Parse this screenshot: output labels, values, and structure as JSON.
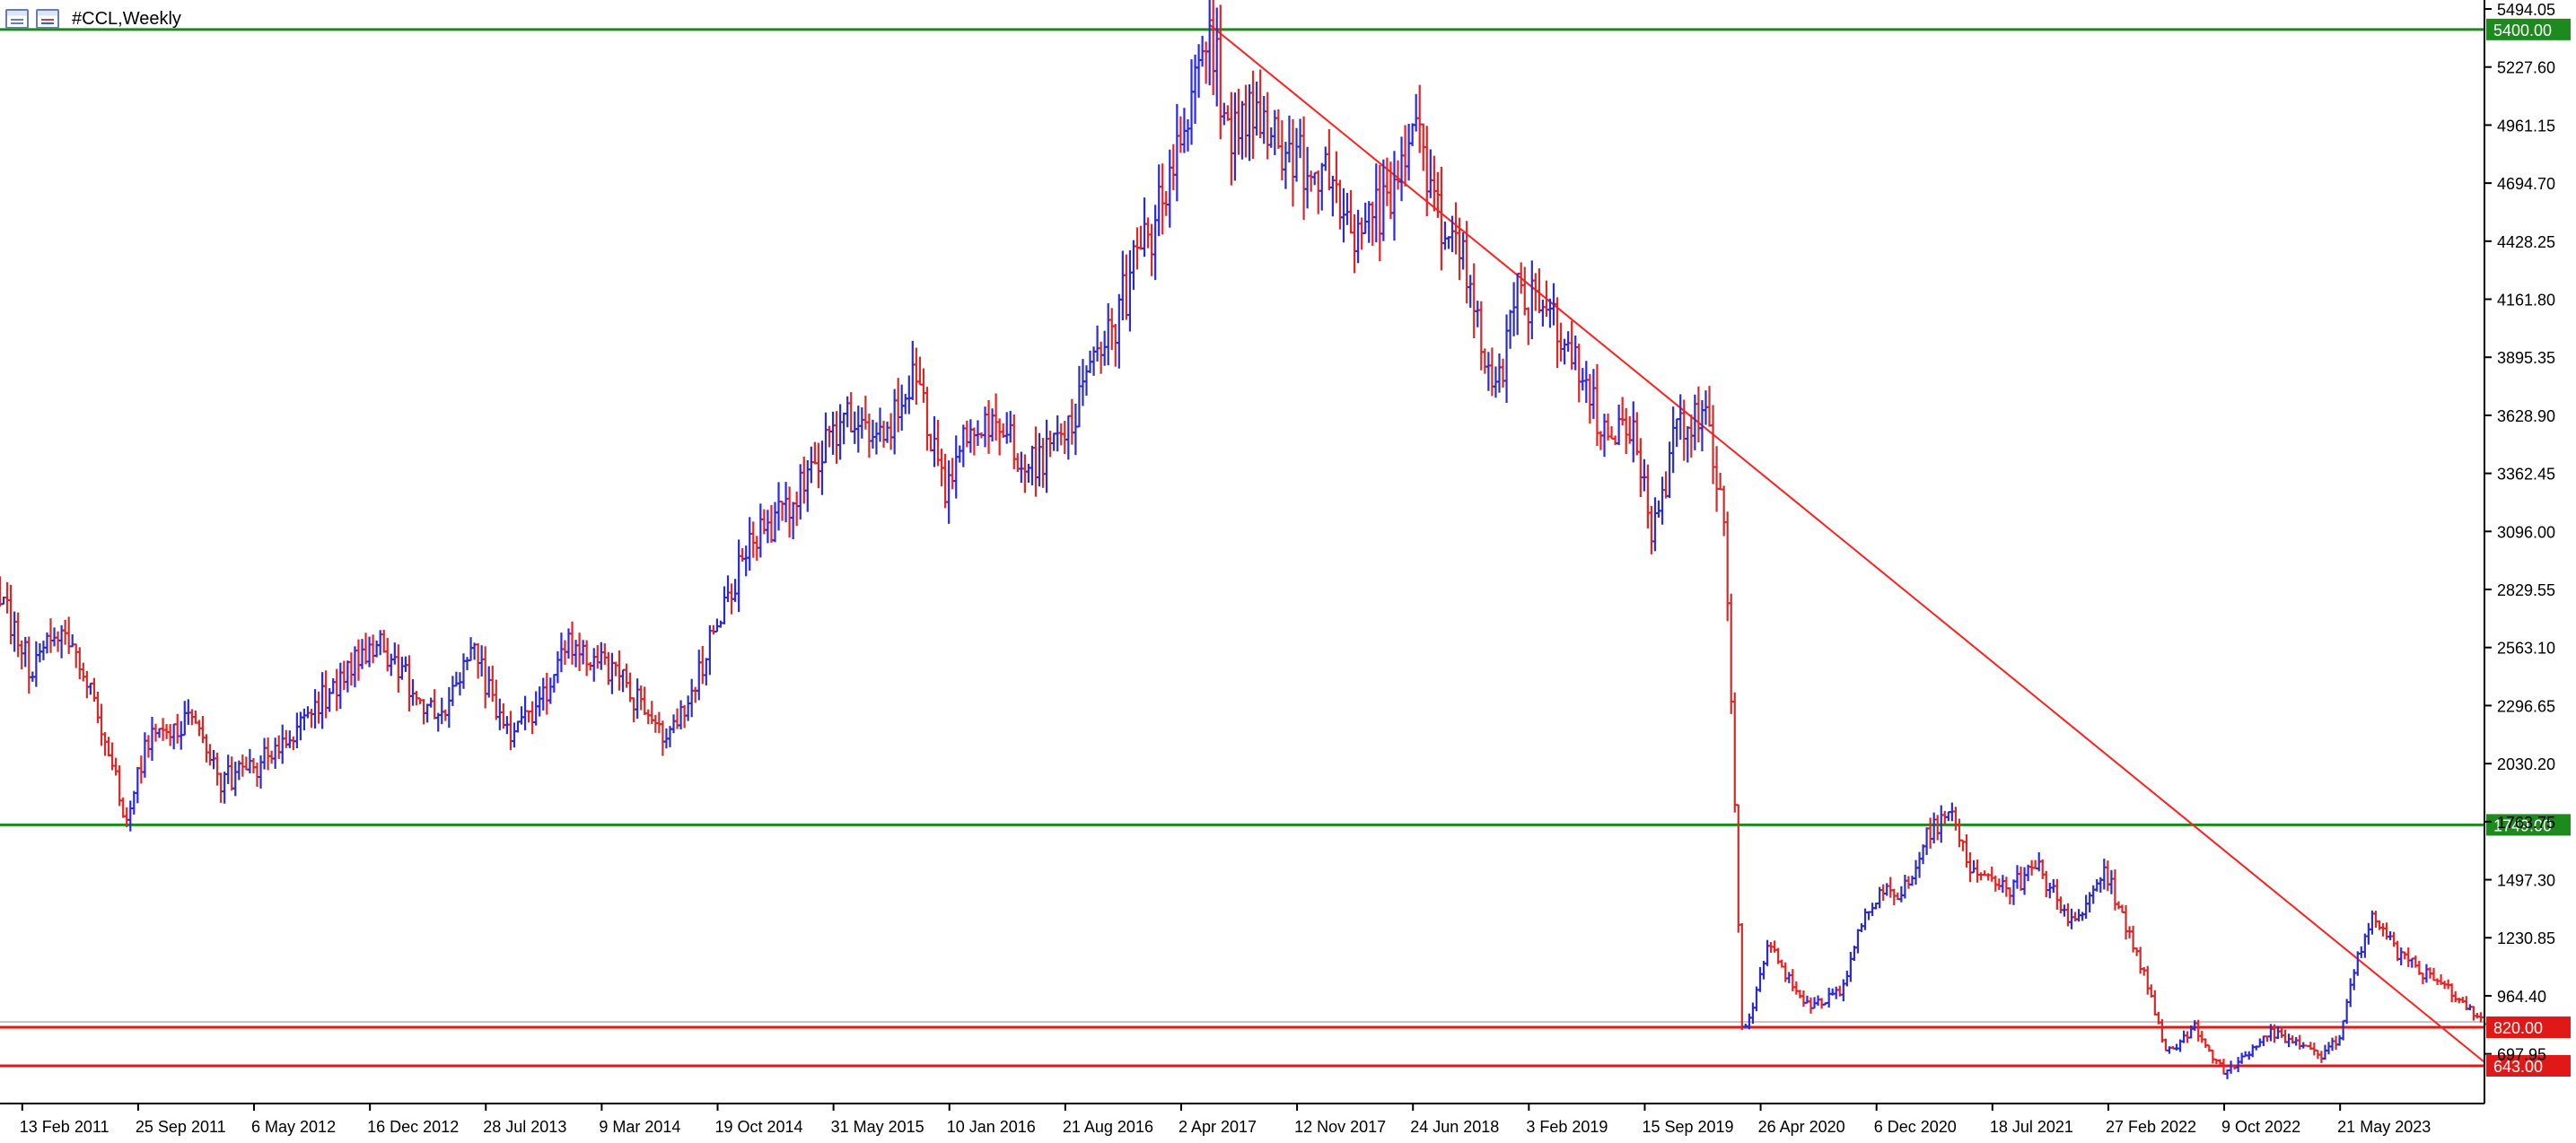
{
  "window": {
    "title": "#CCL,Weekly",
    "icons": [
      "window-list-icon",
      "bar-chart-icon"
    ]
  },
  "colors": {
    "bull": "#2b2bd6",
    "bear": "#e02525",
    "neutral": "#28b428",
    "resistance": "#1d8a1d",
    "support": "#e01818",
    "trendline": "#ff2020",
    "axis_text": "#000000"
  },
  "chart_data": {
    "type": "candlestick",
    "title": "#CCL,Weekly",
    "ylim": [
      470,
      5494.05
    ],
    "x_range": [
      "2011-01-01",
      "2024-02-24"
    ],
    "y_ticks": [
      "5494.05",
      "5227.60",
      "4961.15",
      "4694.70",
      "4428.25",
      "4161.80",
      "3895.35",
      "3628.90",
      "3362.45",
      "3096.00",
      "2829.55",
      "2563.10",
      "2296.65",
      "2030.20",
      "1763.75",
      "1497.30",
      "1230.85",
      "964.40",
      "697.95"
    ],
    "x_ticks": [
      "13 Feb 2011",
      "25 Sep 2011",
      "6 May 2012",
      "16 Dec 2012",
      "28 Jul 2013",
      "9 Mar 2014",
      "19 Oct 2014",
      "31 May 2015",
      "10 Jan 2016",
      "21 Aug 2016",
      "2 Apr 2017",
      "12 Nov 2017",
      "24 Jun 2018",
      "3 Feb 2019",
      "15 Sep 2019",
      "26 Apr 2020",
      "6 Dec 2020",
      "18 Jul 2021",
      "27 Feb 2022",
      "9 Oct 2022",
      "21 May 2023"
    ],
    "horizontal_levels": [
      {
        "value": 5400,
        "label": "5400.00",
        "color": "#1d8a1d"
      },
      {
        "value": 1749,
        "label": "1749.00",
        "color": "#1d8a1d"
      },
      {
        "value": 820,
        "label": "820.00",
        "color": "#e01818"
      },
      {
        "value": 643,
        "label": "643.00",
        "color": "#e01818"
      }
    ],
    "current_price": 845,
    "trendline": {
      "from": [
        "2017-05-28",
        5420
      ],
      "to": [
        "2024-02-24",
        660
      ]
    },
    "price_path": [
      [
        "2011-01-01",
        2820
      ],
      [
        "2011-03-01",
        2460
      ],
      [
        "2011-05-01",
        2680
      ],
      [
        "2011-07-01",
        2300
      ],
      [
        "2011-09-01",
        1800
      ],
      [
        "2011-10-15",
        2140
      ],
      [
        "2012-01-01",
        2230
      ],
      [
        "2012-03-01",
        1950
      ],
      [
        "2012-05-01",
        2000
      ],
      [
        "2012-07-01",
        2120
      ],
      [
        "2012-09-01",
        2300
      ],
      [
        "2012-11-01",
        2450
      ],
      [
        "2013-01-01",
        2590
      ],
      [
        "2013-03-01",
        2400
      ],
      [
        "2013-05-01",
        2210
      ],
      [
        "2013-07-01",
        2560
      ],
      [
        "2013-09-15",
        2140
      ],
      [
        "2013-11-01",
        2280
      ],
      [
        "2014-01-01",
        2560
      ],
      [
        "2014-03-01",
        2500
      ],
      [
        "2014-05-01",
        2370
      ],
      [
        "2014-07-01",
        2150
      ],
      [
        "2014-09-01",
        2360
      ],
      [
        "2014-11-01",
        2760
      ],
      [
        "2015-01-01",
        3100
      ],
      [
        "2015-03-01",
        3180
      ],
      [
        "2015-05-01",
        3450
      ],
      [
        "2015-07-01",
        3620
      ],
      [
        "2015-09-01",
        3480
      ],
      [
        "2015-11-01",
        3800
      ],
      [
        "2016-01-01",
        3300
      ],
      [
        "2016-03-01",
        3600
      ],
      [
        "2016-05-01",
        3520
      ],
      [
        "2016-07-01",
        3400
      ],
      [
        "2016-09-01",
        3620
      ],
      [
        "2016-11-01",
        3900
      ],
      [
        "2017-01-01",
        4300
      ],
      [
        "2017-03-01",
        4620
      ],
      [
        "2017-04-15",
        5050
      ],
      [
        "2017-05-28",
        5420
      ],
      [
        "2017-07-01",
        4950
      ],
      [
        "2017-09-01",
        5000
      ],
      [
        "2017-11-01",
        4800
      ],
      [
        "2018-01-01",
        4750
      ],
      [
        "2018-03-01",
        4420
      ],
      [
        "2018-05-01",
        4620
      ],
      [
        "2018-07-01",
        4900
      ],
      [
        "2018-08-15",
        4550
      ],
      [
        "2018-10-01",
        4300
      ],
      [
        "2018-12-01",
        3700
      ],
      [
        "2019-01-15",
        4200
      ],
      [
        "2019-03-01",
        4100
      ],
      [
        "2019-05-01",
        3950
      ],
      [
        "2019-07-01",
        3500
      ],
      [
        "2019-08-15",
        3620
      ],
      [
        "2019-10-01",
        3100
      ],
      [
        "2019-11-15",
        3550
      ],
      [
        "2020-01-15",
        3650
      ],
      [
        "2020-02-15",
        3100
      ],
      [
        "2020-03-01",
        2300
      ],
      [
        "2020-03-20",
        800
      ],
      [
        "2020-04-10",
        900
      ],
      [
        "2020-05-10",
        1200
      ],
      [
        "2020-06-15",
        1050
      ],
      [
        "2020-08-01",
        900
      ],
      [
        "2020-10-01",
        1000
      ],
      [
        "2020-11-15",
        1350
      ],
      [
        "2020-12-20",
        1450
      ],
      [
        "2021-01-20",
        1400
      ],
      [
        "2021-03-10",
        1700
      ],
      [
        "2021-05-01",
        1800
      ],
      [
        "2021-06-15",
        1500
      ],
      [
        "2021-08-15",
        1450
      ],
      [
        "2021-10-15",
        1550
      ],
      [
        "2021-12-15",
        1300
      ],
      [
        "2022-01-20",
        1400
      ],
      [
        "2022-02-20",
        1550
      ],
      [
        "2022-04-01",
        1300
      ],
      [
        "2022-05-15",
        1000
      ],
      [
        "2022-06-20",
        700
      ],
      [
        "2022-08-15",
        820
      ],
      [
        "2022-10-10",
        600
      ],
      [
        "2022-11-25",
        700
      ],
      [
        "2023-01-10",
        800
      ],
      [
        "2023-02-25",
        750
      ],
      [
        "2023-04-10",
        680
      ],
      [
        "2023-05-20",
        780
      ],
      [
        "2023-06-20",
        1100
      ],
      [
        "2023-07-25",
        1340
      ],
      [
        "2023-09-10",
        1150
      ],
      [
        "2023-11-10",
        1050
      ],
      [
        "2024-01-10",
        950
      ],
      [
        "2024-02-24",
        845
      ]
    ]
  }
}
